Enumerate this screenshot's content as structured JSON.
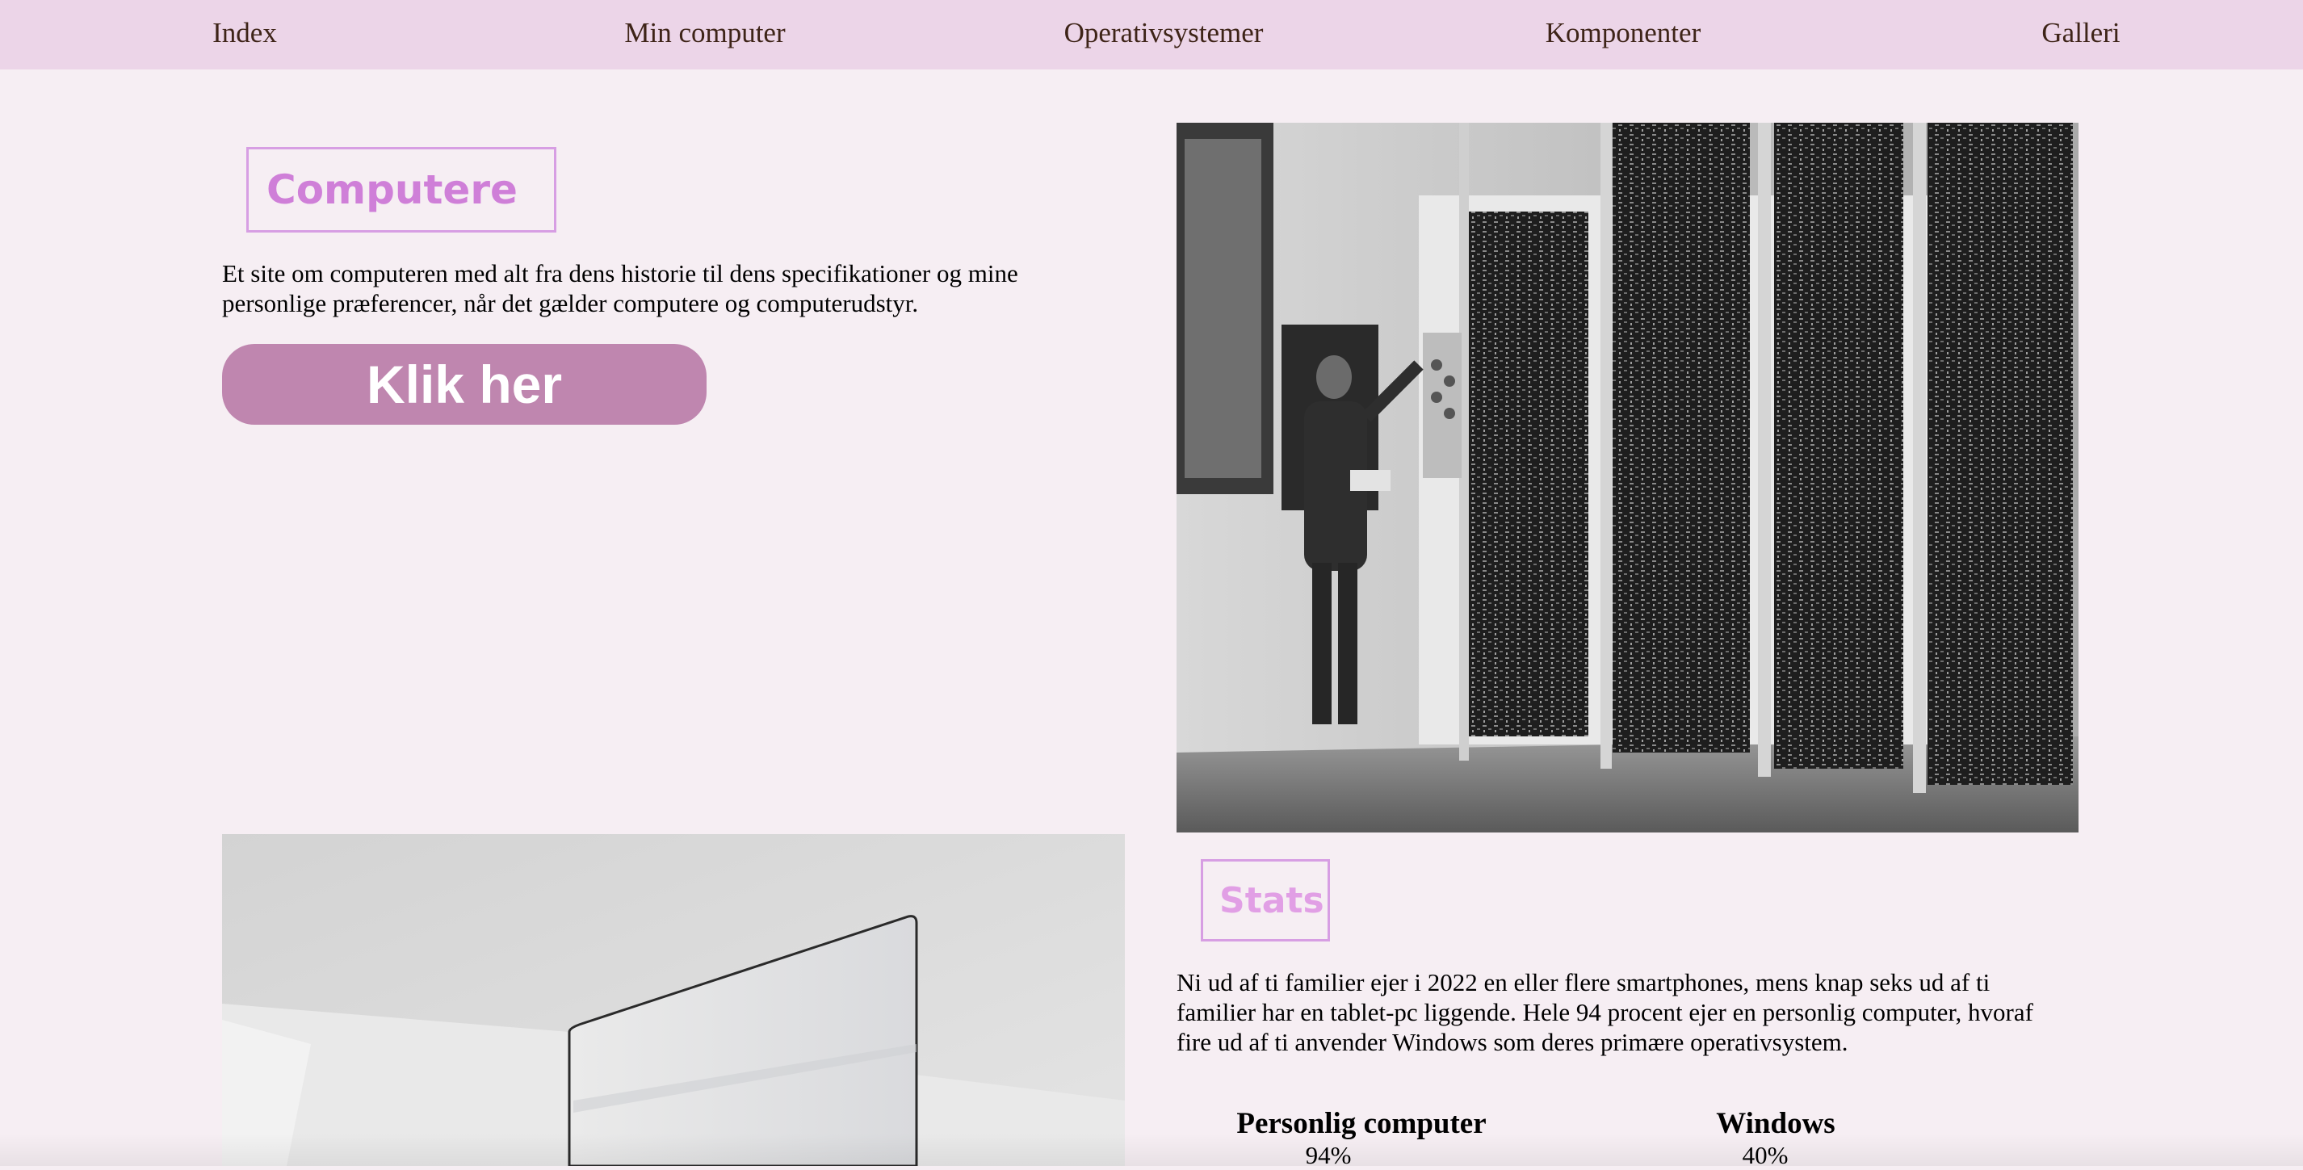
{
  "nav": {
    "items": [
      {
        "label": "Index"
      },
      {
        "label": "Min computer"
      },
      {
        "label": "Operativsystemer"
      },
      {
        "label": "Komponenter"
      },
      {
        "label": "Galleri"
      }
    ]
  },
  "hero": {
    "title": "Computere",
    "text_line1": "Et site om computeren med alt fra dens historie til dens specifikationer og mine",
    "text_line2": "personlige præferencer, når det gælder computere og computerudstyr.",
    "button_label": "Klik her"
  },
  "stats": {
    "title": "Stats",
    "text_line1": "Ni ud af ti familier ejer i 2022 en eller flere smartphones, mens knap seks ud af ti",
    "text_line2": "familier har en tablet-pc liggende. Hele 94 procent ejer en personlig computer, hvoraf",
    "text_line3": "fire ud af ti anvender Windows som deres primære operativsystem.",
    "items": [
      {
        "label": "Personlig computer",
        "value": "94%"
      },
      {
        "label": "Windows",
        "value": "40%"
      }
    ]
  },
  "colors": {
    "nav_bg": "#ecd5e8",
    "page_bg": "#f6eef3",
    "accent": "#cf7fd8",
    "button_bg": "#bf86af"
  }
}
